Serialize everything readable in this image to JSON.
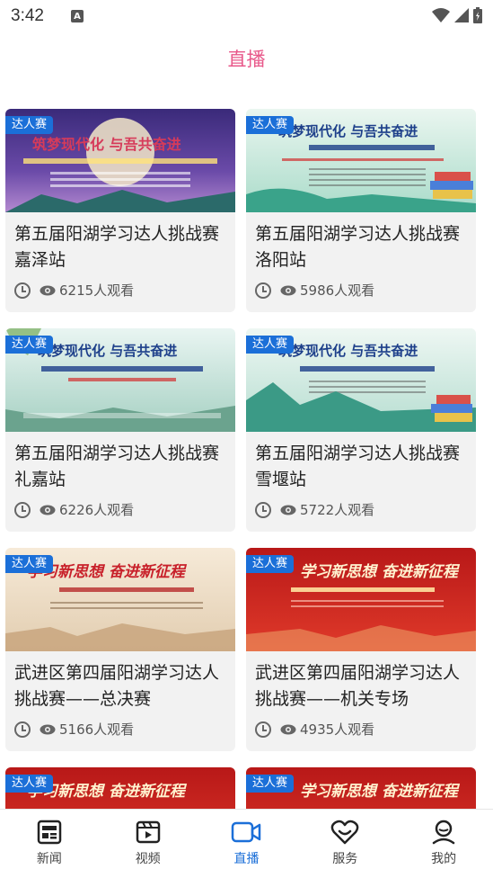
{
  "status": {
    "time": "3:42",
    "notif": "A"
  },
  "title": "直播",
  "badge": "达人赛",
  "cards": [
    {
      "title": "第五届阳湖学习达人挑战赛嘉泽站",
      "views": "6215人观看",
      "thumb_text": "筑梦现代化 与吾共奋进"
    },
    {
      "title": "第五届阳湖学习达人挑战赛洛阳站",
      "views": "5986人观看",
      "thumb_text": "筑梦现代化 与吾共奋进"
    },
    {
      "title": "第五届阳湖学习达人挑战赛礼嘉站",
      "views": "6226人观看",
      "thumb_text": "筑梦现代化 与吾共奋进"
    },
    {
      "title": "第五届阳湖学习达人挑战赛雪堰站",
      "views": "5722人观看",
      "thumb_text": "筑梦现代化 与吾共奋进"
    },
    {
      "title": "武进区第四届阳湖学习达人挑战赛——总决赛",
      "views": "5166人观看",
      "thumb_text": "学习新思想 奋进新征程"
    },
    {
      "title": "武进区第四届阳湖学习达人挑战赛——机关专场",
      "views": "4935人观看",
      "thumb_text": "学习新思想 奋进新征程"
    },
    {
      "thumb_text": "学习新思想 奋进新征程"
    },
    {
      "thumb_text": "学习新思想 奋进新征程"
    }
  ],
  "nav": [
    {
      "label": "新闻",
      "icon": "news-icon"
    },
    {
      "label": "视频",
      "icon": "video-icon"
    },
    {
      "label": "直播",
      "icon": "live-icon"
    },
    {
      "label": "服务",
      "icon": "service-icon"
    },
    {
      "label": "我的",
      "icon": "profile-icon"
    }
  ],
  "colors": {
    "accent": "#1b6fd8",
    "title": "#e8588a",
    "badge": "#1b6fd8"
  }
}
